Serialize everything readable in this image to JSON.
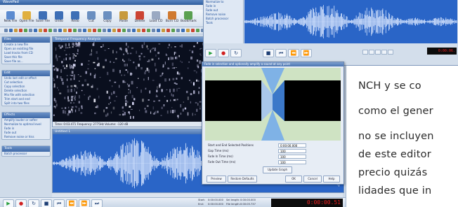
{
  "app": {
    "title": "WavePad",
    "menu": [
      "File",
      "Edit",
      "Effects",
      "Tools",
      "Bookmarks",
      "View",
      "Window",
      "Help"
    ]
  },
  "toolbar": {
    "buttons": [
      {
        "label": "New File",
        "icon": "new-file-icon",
        "color": "#5b8bd0"
      },
      {
        "label": "Open File",
        "icon": "open-file-icon",
        "color": "#e0b040"
      },
      {
        "label": "Save File",
        "icon": "save-file-icon",
        "color": "#3d6fb6"
      },
      {
        "label": "Undo",
        "icon": "undo-icon",
        "color": "#3d6fb6"
      },
      {
        "label": "Redo",
        "icon": "redo-icon",
        "color": "#3d6fb6"
      },
      {
        "label": "Cut",
        "icon": "cut-icon",
        "color": "#6a8fc0"
      },
      {
        "label": "Copy",
        "icon": "copy-icon",
        "color": "#6a8fc0"
      },
      {
        "label": "Paste",
        "icon": "paste-icon",
        "color": "#c79a3d"
      },
      {
        "label": "Delete",
        "icon": "delete-icon",
        "color": "#cc4433"
      },
      {
        "label": "Load CD",
        "icon": "load-cd-icon",
        "color": "#9aa9c2"
      },
      {
        "label": "Burn CD",
        "icon": "burn-cd-icon",
        "color": "#d07a30"
      },
      {
        "label": "Bookmark",
        "icon": "bookmark-icon",
        "color": "#5aa050"
      }
    ]
  },
  "sidebar": {
    "panels": [
      {
        "title": "Files",
        "items": [
          "Create a new file",
          "Open an existing file",
          "Load tracks from CD",
          "Save this file",
          "Save file as..."
        ]
      },
      {
        "title": "Edit",
        "items": [
          "Undo last edit or effect",
          "Cut selection",
          "Copy selection",
          "Delete selection",
          "Mix file with selection",
          "Trim start and end",
          "Split into two files"
        ]
      },
      {
        "title": "Effects",
        "items": [
          "Amplify louder or softer",
          "Normalize to optimal level",
          "Fade in",
          "Fade out",
          "Remove noise or hiss"
        ]
      },
      {
        "title": "Tools",
        "items": [
          "Batch processor"
        ]
      }
    ]
  },
  "spectrum_window": {
    "title": "Temporal Frequency Analysis",
    "status": "Time: 0:03.471   Frequency: 2775Hz   Volume: -120 dB"
  },
  "wave_window": {
    "title": "Untitled 1"
  },
  "tabs": [
    "TFT Window",
    "Untitled 1"
  ],
  "transport": {
    "counter": "0:00:00.51",
    "start_label": "Start:",
    "start_value": "0:00:00.000",
    "end_label": "End:",
    "end_value": "0:00:00.000",
    "sel_label": "Sel length:",
    "sel_value": "0:00:00.000",
    "file_label": "File length:",
    "file_value": "0:00:05.737"
  },
  "second_window": {
    "side_items": [
      "Normalize to",
      "Fade in",
      "Fade out",
      "Remove noise",
      "Batch processor",
      "Tools"
    ],
    "counter": "0:00:06."
  },
  "dialog": {
    "title": "Fade in selection and optionally amplify a sound at any point",
    "fields": [
      {
        "label": "Start and End Selected Positions",
        "value": "0:00:00.000"
      },
      {
        "label": "Gap Time (ms)",
        "value": "100"
      },
      {
        "label": "Fade In Time (ms)",
        "value": "100"
      },
      {
        "label": "Fade Out Time (ms)",
        "value": "100"
      }
    ],
    "update_label": "Update Graph",
    "preview_label": "Preview",
    "restore_label": "Restore Defaults",
    "ok_label": "OK",
    "cancel_label": "Cancel",
    "help_label": "Help"
  },
  "article": {
    "lines": [
      "NCH y se co",
      "como el gener",
      "no se incluyen",
      "de este editor",
      "precio quizás",
      "lidades que in"
    ]
  }
}
